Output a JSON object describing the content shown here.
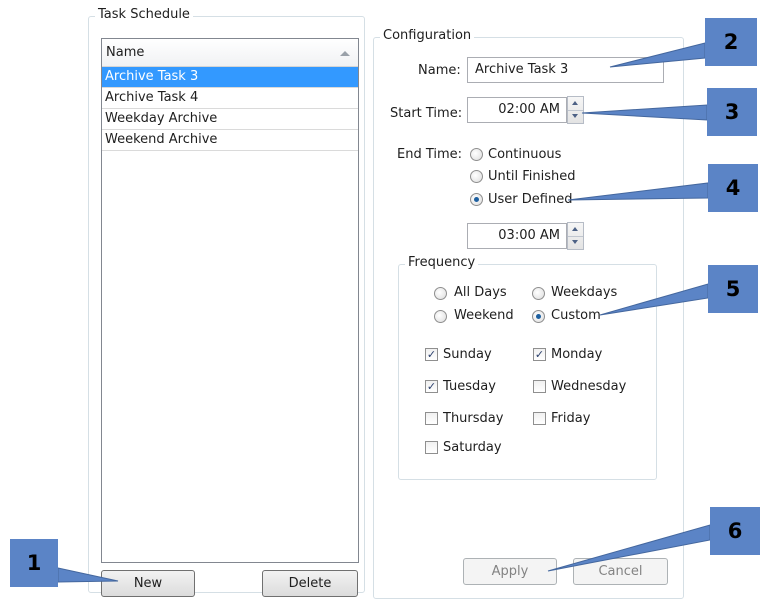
{
  "task_schedule": {
    "title": "Task Schedule",
    "list": {
      "column_header": "Name",
      "rows": [
        {
          "name": "Archive Task 3",
          "selected": true
        },
        {
          "name": "Archive Task 4",
          "selected": false
        },
        {
          "name": "Weekday Archive",
          "selected": false
        },
        {
          "name": "Weekend Archive",
          "selected": false
        }
      ]
    },
    "new_label": "New",
    "delete_label": "Delete"
  },
  "configuration": {
    "title": "Configuration",
    "name_label": "Name:",
    "name_value": "Archive Task 3",
    "start_time_label": "Start Time:",
    "start_time_value": "02:00 AM",
    "end_time_label": "End Time:",
    "end_options": [
      {
        "label": "Continuous",
        "selected": false
      },
      {
        "label": "Until Finished",
        "selected": false
      },
      {
        "label": "User Defined",
        "selected": true
      }
    ],
    "end_time_value": "03:00 AM",
    "frequency": {
      "title": "Frequency",
      "options": [
        {
          "label": "All Days",
          "selected": false
        },
        {
          "label": "Weekdays",
          "selected": false
        },
        {
          "label": "Weekend",
          "selected": false
        },
        {
          "label": "Custom",
          "selected": true
        }
      ],
      "days": [
        {
          "label": "Sunday",
          "checked": true
        },
        {
          "label": "Monday",
          "checked": true
        },
        {
          "label": "Tuesday",
          "checked": true
        },
        {
          "label": "Wednesday",
          "checked": false
        },
        {
          "label": "Thursday",
          "checked": false
        },
        {
          "label": "Friday",
          "checked": false
        },
        {
          "label": "Saturday",
          "checked": false
        }
      ]
    },
    "apply_label": "Apply",
    "cancel_label": "Cancel"
  },
  "callouts": [
    "1",
    "2",
    "3",
    "4",
    "5",
    "6"
  ],
  "colors": {
    "callout": "#5b84c6",
    "selection": "#3399ff",
    "group_border": "#d5dfe5"
  }
}
